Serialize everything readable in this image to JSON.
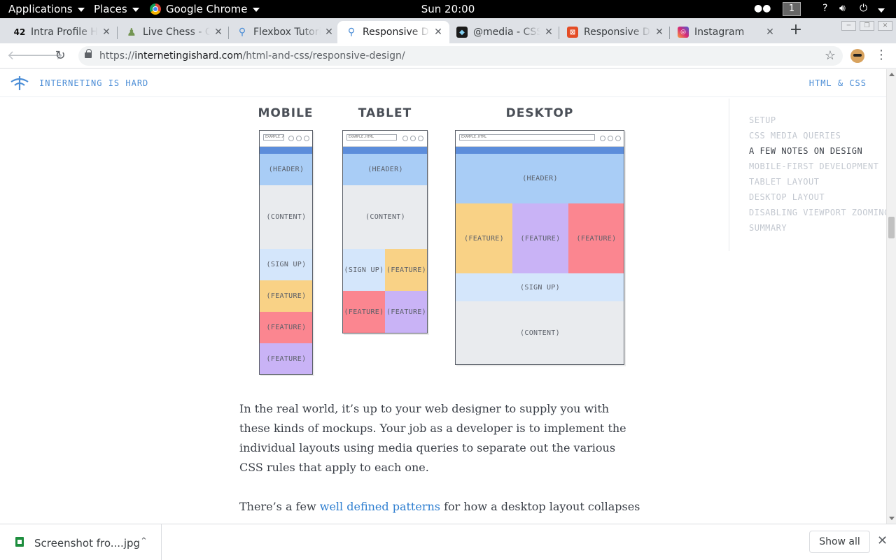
{
  "topbar": {
    "applications": "Applications",
    "places": "Places",
    "browser_app": "Google Chrome",
    "clock": "Sun 20:00",
    "workspace": "1",
    "help": "?"
  },
  "tabs": [
    {
      "label": "Intra Profile Home",
      "favicon": "42-icon",
      "active": false
    },
    {
      "label": "Live Chess - Chess.com",
      "favicon": "chess-pawn-icon",
      "active": false
    },
    {
      "label": "Flexbox Tutorial",
      "favicon": "ih-logo-icon",
      "active": false
    },
    {
      "label": "Responsive Design",
      "favicon": "ih-logo-icon",
      "active": true
    },
    {
      "label": "@media - CSS",
      "favicon": "mdn-icon",
      "active": false
    },
    {
      "label": "Responsive Design",
      "favicon": "w3schools-icon",
      "active": false
    },
    {
      "label": "Instagram",
      "favicon": "instagram-icon",
      "active": false
    }
  ],
  "address": {
    "scheme": "https://",
    "host": "internetingishard.com",
    "path": "/html-and-css/responsive-design/"
  },
  "site": {
    "brand": "INTERNETING IS HARD",
    "section": "HTML & CSS"
  },
  "toc": {
    "active_index": 2,
    "items": [
      "SETUP",
      "CSS MEDIA QUERIES",
      "A FEW NOTES ON DESIGN",
      "MOBILE-FIRST DEVELOPMENT",
      "TABLET LAYOUT",
      "DESKTOP LAYOUT",
      "DISABLING VIEWPORT ZOOMING",
      "SUMMARY"
    ]
  },
  "mockups": {
    "mobile": {
      "title": "MOBILE",
      "url": "EXAMPLE.AT",
      "blocks": [
        "(HEADER)",
        "(CONTENT)",
        "(SIGN UP)",
        "(FEATURE)",
        "(FEATURE)",
        "(FEATURE)"
      ]
    },
    "tablet": {
      "title": "TABLET",
      "url": "EXAMPLE.HTML",
      "blocks": [
        "(HEADER)",
        "(CONTENT)",
        "(SIGN UP)",
        "(FEATURE)",
        "(FEATURE)",
        "(FEATURE)"
      ]
    },
    "desktop": {
      "title": "DESKTOP",
      "url": "EXAMPLE.HTML",
      "blocks": [
        "(HEADER)",
        "(FEATURE)",
        "(FEATURE)",
        "(FEATURE)",
        "(SIGN UP)",
        "(CONTENT)"
      ]
    },
    "colors": {
      "header": "#a9cdf6",
      "content": "#e9ebee",
      "signup": "#d4e6fb",
      "feature_yellow": "#f9d286",
      "feature_red": "#fb8690",
      "feature_purple": "#c9b3f6",
      "browser_band": "#5c8ddb"
    }
  },
  "article": {
    "para1": "In the real world, it’s up to your web designer to supply you with these kinds of mockups. Your job as a developer is to implement the individual layouts using media queries to separate out the various CSS rules that apply to each one.",
    "para2_start": "There’s a few ",
    "para2_link": "well defined patterns",
    "para2_rest": " for how a desktop layout collapses into a"
  },
  "downloads": {
    "file": "Screenshot fro....jpg",
    "show_all": "Show all"
  },
  "colors": {
    "accent": "#4b8dd6",
    "link": "#2f7fd0",
    "text": "#3a3f47"
  }
}
